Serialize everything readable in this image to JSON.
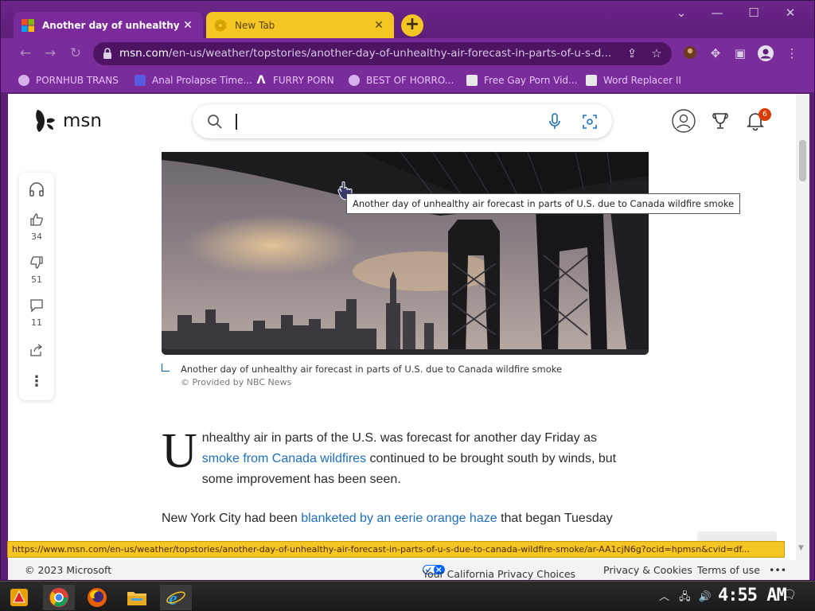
{
  "browser": {
    "tabs": [
      {
        "title": "Another day of unhealthy air f",
        "active": true
      },
      {
        "title": "New Tab",
        "active": false
      }
    ],
    "url": {
      "domain": "msn.com",
      "path": "/en-us/weather/topstories/another-day-of-unhealthy-air-forecast-in-parts-of-u-s-d..."
    },
    "bookmarks": [
      "PORNHUB TRANS",
      "Anal Prolapse Time...",
      "FURRY PORN",
      "BEST OF HORRO...",
      "Free Gay Porn Vid...",
      "Word Replacer II"
    ],
    "status_url": "https://www.msn.com/en-us/weather/topstories/another-day-of-unhealthy-air-forecast-in-parts-of-u-s-due-to-canada-wildfire-smoke/ar-AA1cjN6g?ocid=hpmsn&cvid=df..."
  },
  "msn": {
    "brand": "msn",
    "search_value": "",
    "notification_count": "6"
  },
  "rail": {
    "likes": "34",
    "dislikes": "51",
    "comments": "11"
  },
  "article": {
    "tooltip": "Another day of unhealthy air forecast in parts of U.S. due to Canada wildfire smoke",
    "caption": "Another day of unhealthy air forecast in parts of U.S. due to Canada wildfire smoke",
    "credit": "© Provided by NBC News",
    "dropcap": "U",
    "p1_a": "nhealthy air in parts of the U.S. was forecast for another day Friday as",
    "p1_link": "smoke from Canada wildfires",
    "p1_b": " continued to be brought south by winds, but some improvement has been seen.",
    "p2_a": "New York City had been ",
    "p2_link": "blanketed by an eerie orange haze",
    "p2_b": " that began Tuesday"
  },
  "footer": {
    "copyright": "© 2023 Microsoft",
    "privacy_choices": "Your California Privacy Choices",
    "privacy_cookies": "Privacy & Cookies",
    "terms": "Terms of use",
    "more": "•••"
  },
  "taskbar": {
    "clock": "4:55 AM"
  },
  "colors": {
    "browser_frame": "#6c2589",
    "tab_accent": "#f5c523",
    "link": "#1f6fbf"
  }
}
